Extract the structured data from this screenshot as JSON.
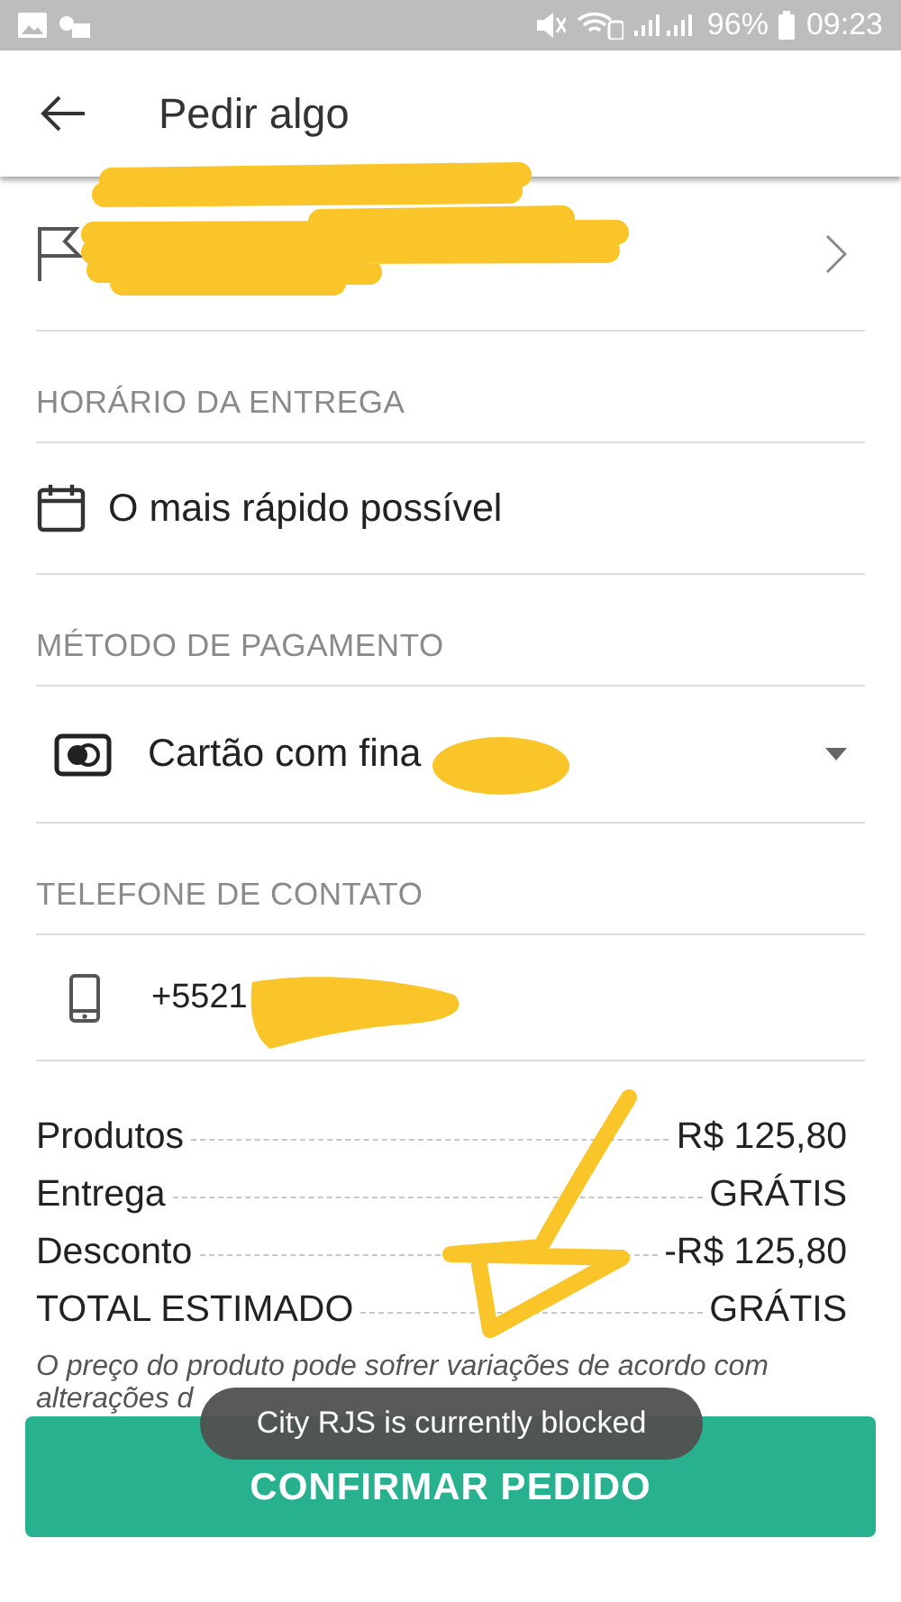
{
  "status_bar": {
    "battery": "96%",
    "time": "09:23"
  },
  "header": {
    "title": "Pedir algo"
  },
  "sections": [
    {
      "kind": "address"
    },
    {
      "kind": "time",
      "heading": "HORÁRIO DA ENTREGA",
      "value": "O mais rápido possível"
    },
    {
      "kind": "payment",
      "heading": "MÉTODO DE PAGAMENTO",
      "value": "Cartão com fina"
    },
    {
      "kind": "phone",
      "heading": "TELEFONE DE CONTATO",
      "value": "+5521"
    }
  ],
  "summary": [
    {
      "label": "Produtos",
      "value": "R$ 125,80"
    },
    {
      "label": "Entrega",
      "value": "GRÁTIS"
    },
    {
      "label": "Desconto",
      "value": "-R$ 125,80"
    },
    {
      "label": "TOTAL ESTIMADO",
      "value": "GRÁTIS"
    }
  ],
  "note": [
    "O preço do produto pode sofrer variações de acordo com",
    "alterações d"
  ],
  "toast": "City RJS is currently blocked",
  "confirm_button": "CONFIRMAR PEDIDO"
}
